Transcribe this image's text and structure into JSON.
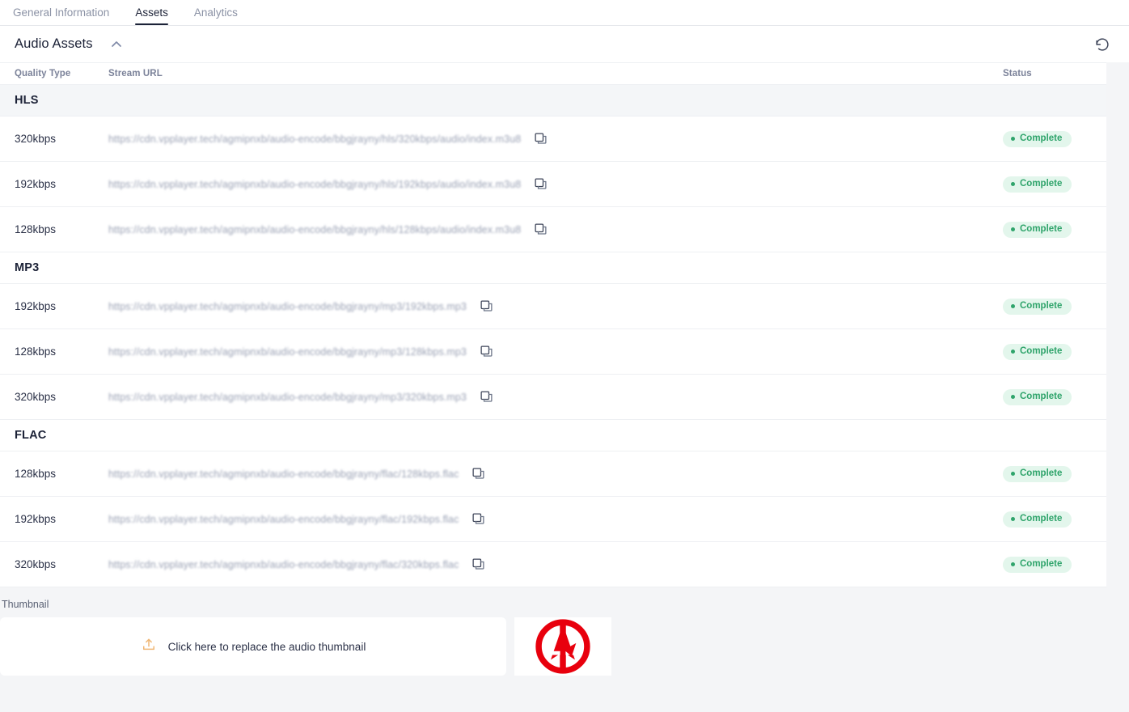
{
  "tabs": [
    {
      "label": "General Information",
      "active": false
    },
    {
      "label": "Assets",
      "active": true
    },
    {
      "label": "Analytics",
      "active": false
    }
  ],
  "section": {
    "title": "Audio Assets",
    "collapse_icon": "chevron-up-icon",
    "refresh_icon": "refresh-ccw-icon"
  },
  "table": {
    "columns": [
      "Quality Type",
      "Stream URL",
      "Status"
    ],
    "copy_icon": "copy-icon",
    "groups": [
      {
        "label": "HLS",
        "shaded": true,
        "rows": [
          {
            "quality": "320kbps",
            "url": "https://cdn.vpplayer.tech/agmipnxb/audio-encode/bbgjrayny/hls/320kbps/audio/index.m3u8",
            "status": "Complete"
          },
          {
            "quality": "192kbps",
            "url": "https://cdn.vpplayer.tech/agmipnxb/audio-encode/bbgjrayny/hls/192kbps/audio/index.m3u8",
            "status": "Complete"
          },
          {
            "quality": "128kbps",
            "url": "https://cdn.vpplayer.tech/agmipnxb/audio-encode/bbgjrayny/hls/128kbps/audio/index.m3u8",
            "status": "Complete"
          }
        ]
      },
      {
        "label": "MP3",
        "shaded": false,
        "rows": [
          {
            "quality": "192kbps",
            "url": "https://cdn.vpplayer.tech/agmipnxb/audio-encode/bbgjrayny/mp3/192kbps.mp3",
            "status": "Complete"
          },
          {
            "quality": "128kbps",
            "url": "https://cdn.vpplayer.tech/agmipnxb/audio-encode/bbgjrayny/mp3/128kbps.mp3",
            "status": "Complete"
          },
          {
            "quality": "320kbps",
            "url": "https://cdn.vpplayer.tech/agmipnxb/audio-encode/bbgjrayny/mp3/320kbps.mp3",
            "status": "Complete"
          }
        ]
      },
      {
        "label": "FLAC",
        "shaded": false,
        "rows": [
          {
            "quality": "128kbps",
            "url": "https://cdn.vpplayer.tech/agmipnxb/audio-encode/bbgjrayny/flac/128kbps.flac",
            "status": "Complete"
          },
          {
            "quality": "192kbps",
            "url": "https://cdn.vpplayer.tech/agmipnxb/audio-encode/bbgjrayny/flac/192kbps.flac",
            "status": "Complete"
          },
          {
            "quality": "320kbps",
            "url": "https://cdn.vpplayer.tech/agmipnxb/audio-encode/bbgjrayny/flac/320kbps.flac",
            "status": "Complete"
          }
        ]
      }
    ]
  },
  "thumbnail": {
    "label": "Thumbnail",
    "dropzone_text": "Click here to replace the audio thumbnail",
    "upload_icon": "upload-icon",
    "preview_icon": "avengers-logo"
  },
  "colors": {
    "page_bg": "#f4f5f7",
    "surface": "#ffffff",
    "text_primary": "#1c2237",
    "text_muted": "#8b92a5",
    "url_text": "#9aa1b4",
    "divider": "#eef0f3",
    "group_shaded": "#f4f6f8",
    "status_text": "#2fa46b",
    "status_bg": "#e3f6ec",
    "upload_icon": "#f0b775",
    "logo_red": "#e8000d"
  }
}
